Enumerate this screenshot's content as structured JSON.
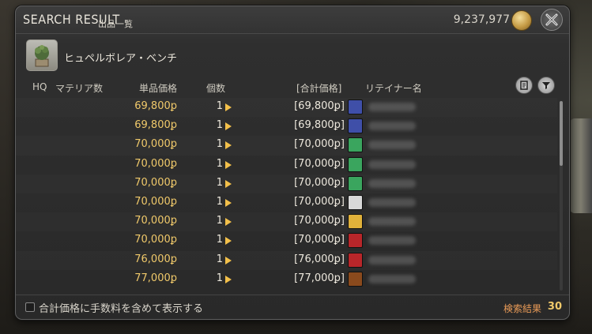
{
  "window": {
    "title": "SEARCH RESULT",
    "subtitle": "出品一覧",
    "gil": "9,237,977"
  },
  "item": {
    "name": "ヒュペルボレア・ベンチ"
  },
  "columns": {
    "hq": "HQ",
    "materia": "マテリア数",
    "unit_price": "単品価格",
    "quantity": "個数",
    "total": "[合計価格]",
    "retainer": "リテイナー名"
  },
  "rows": [
    {
      "price": "69,800ꝑ",
      "qty": "1",
      "total": "[69,800ꝑ]",
      "city_icon": "red-blue-crest-icon",
      "city_color": "#3f4fa8"
    },
    {
      "price": "69,800ꝑ",
      "qty": "1",
      "total": "[69,800ꝑ]",
      "city_icon": "red-blue-crest-icon",
      "city_color": "#3f4fa8"
    },
    {
      "price": "70,000ꝑ",
      "qty": "1",
      "total": "[70,000ꝑ]",
      "city_icon": "green-swirl-icon",
      "city_color": "#3aa55e"
    },
    {
      "price": "70,000ꝑ",
      "qty": "1",
      "total": "[70,000ꝑ]",
      "city_icon": "green-swirl-icon",
      "city_color": "#3aa55e"
    },
    {
      "price": "70,000ꝑ",
      "qty": "1",
      "total": "[70,000ꝑ]",
      "city_icon": "green-swirl-icon",
      "city_color": "#3aa55e"
    },
    {
      "price": "70,000ꝑ",
      "qty": "1",
      "total": "[70,000ꝑ]",
      "city_icon": "white-spiral-icon",
      "city_color": "#d8d8d8"
    },
    {
      "price": "70,000ꝑ",
      "qty": "1",
      "total": "[70,000ꝑ]",
      "city_icon": "yellow-key-icon",
      "city_color": "#e0b13a"
    },
    {
      "price": "70,000ꝑ",
      "qty": "1",
      "total": "[70,000ꝑ]",
      "city_icon": "red-tower-icon",
      "city_color": "#b8262a"
    },
    {
      "price": "76,000ꝑ",
      "qty": "1",
      "total": "[76,000ꝑ]",
      "city_icon": "red-tower-icon",
      "city_color": "#b8262a"
    },
    {
      "price": "77,000ꝑ",
      "qty": "1",
      "total": "[77,000ꝑ]",
      "city_icon": "orange-scale-icon",
      "city_color": "#8a4a1d"
    }
  ],
  "footer": {
    "checkbox_label": "合計価格に手数料を含めて表示する",
    "result_label": "検索結果",
    "result_count": "30"
  }
}
